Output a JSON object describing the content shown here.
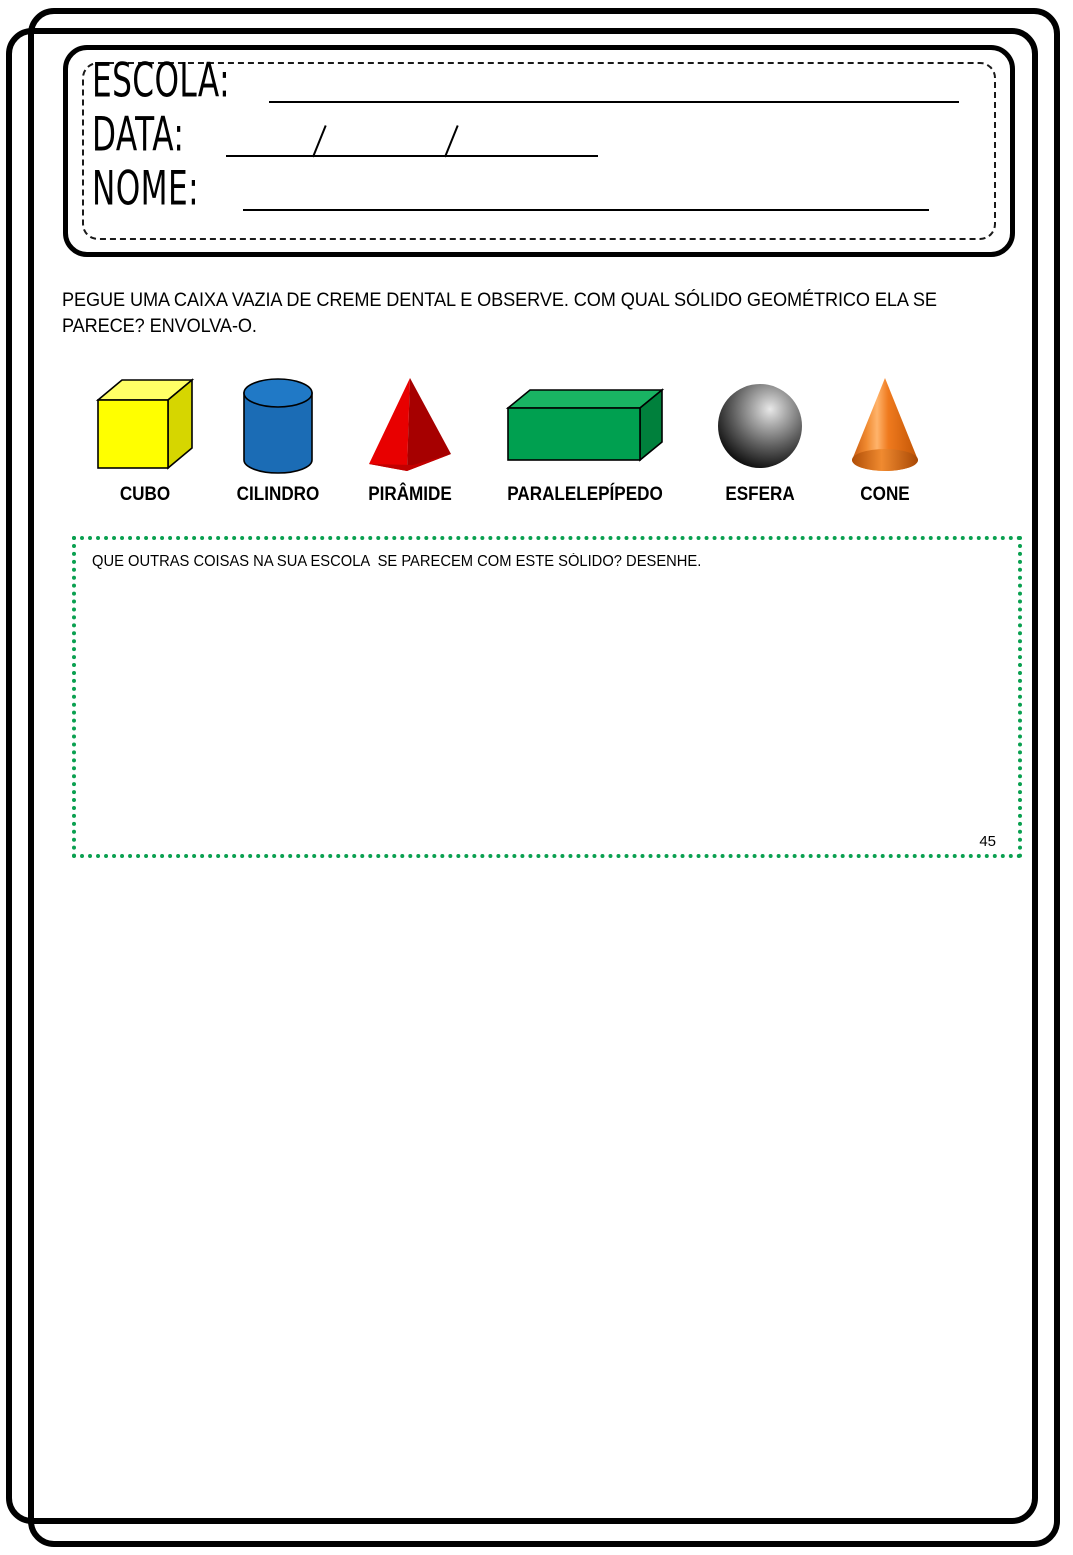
{
  "page": {
    "number": "45",
    "background_color": "#ffffff",
    "frame_color": "#000000"
  },
  "header": {
    "fields": [
      {
        "label": "ESCOLA:",
        "name": "escola"
      },
      {
        "label": "DATA:",
        "name": "data"
      },
      {
        "label": "NOME:",
        "name": "nome"
      }
    ],
    "escola_label": "ESCOLA:",
    "data_label": "DATA:",
    "nome_label": "NOME:"
  },
  "instruction": {
    "text": "PEGUE UMA CAIXA VAZIA DE CREME DENTAL E OBSERVE. COM QUAL SÓLIDO GEOMÉTRICO ELA SE PARECE? ENVOLVA-O."
  },
  "solids": [
    {
      "id": "cubo",
      "label": "CUBO",
      "icon": "cube-icon",
      "color": "#ffff00"
    },
    {
      "id": "cilindro",
      "label": "CILINDRO",
      "icon": "cylinder-icon",
      "color": "#1b6cb5"
    },
    {
      "id": "piramide",
      "label": "PIRÂMIDE",
      "icon": "pyramid-icon",
      "color": "#d8000c"
    },
    {
      "id": "paralelepipedo",
      "label": "PARALELEPÍPEDO",
      "icon": "cuboid-icon",
      "color": "#00a050"
    },
    {
      "id": "esfera",
      "label": "ESFERA",
      "icon": "sphere-icon",
      "color": "#808080"
    },
    {
      "id": "cone",
      "label": "CONE",
      "icon": "cone-icon",
      "color": "#f07820"
    }
  ],
  "answer_area": {
    "prompt": "QUE OUTRAS COISAS NA SUA ESCOLA  SE PARECEM COM ESTE SÓLIDO? DESENHE.",
    "border_color": "#0aa050",
    "page_number": "45"
  }
}
